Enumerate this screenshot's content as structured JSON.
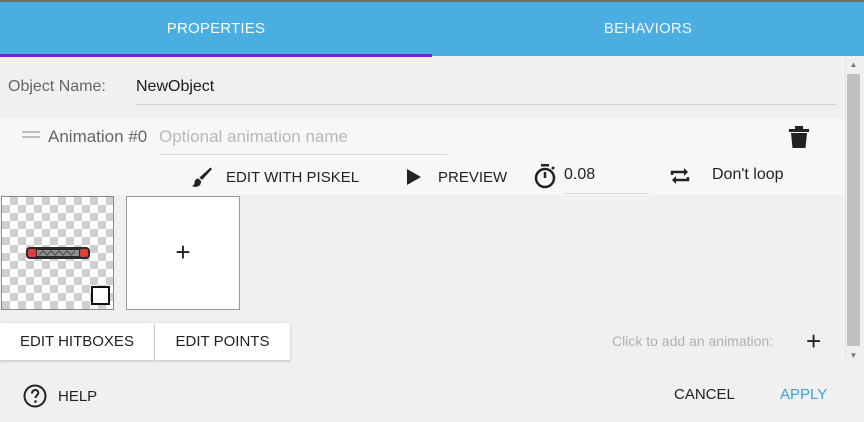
{
  "tabs": [
    {
      "label": "PROPERTIES",
      "active": true
    },
    {
      "label": "BEHAVIORS",
      "active": false
    }
  ],
  "object": {
    "label": "Object Name:",
    "value": "NewObject"
  },
  "animation": {
    "title": "Animation #0",
    "name_placeholder": "Optional animation name",
    "edit_with_piskel_label": "EDIT WITH PISKEL",
    "preview_label": "PREVIEW",
    "duration_value": "0.08",
    "loop_label": "Don't loop"
  },
  "frames": {
    "add_frame_glyph": "+"
  },
  "buttons": {
    "edit_hitboxes": "EDIT HITBOXES",
    "edit_points": "EDIT POINTS",
    "add_animation_hint": "Click to add an animation:",
    "add_animation_glyph": "+"
  },
  "footer": {
    "help": "HELP",
    "cancel": "CANCEL",
    "apply": "APPLY"
  },
  "colors": {
    "tab_bar": "#4aaee0",
    "tab_indicator": "#7b1fd6",
    "apply_accent": "#3aa3dc"
  },
  "icons": [
    "drag-handle-icon",
    "trash-icon",
    "paintbrush-icon",
    "play-icon",
    "timer-icon",
    "loop-icon",
    "help-circle-icon",
    "plus-icon"
  ]
}
